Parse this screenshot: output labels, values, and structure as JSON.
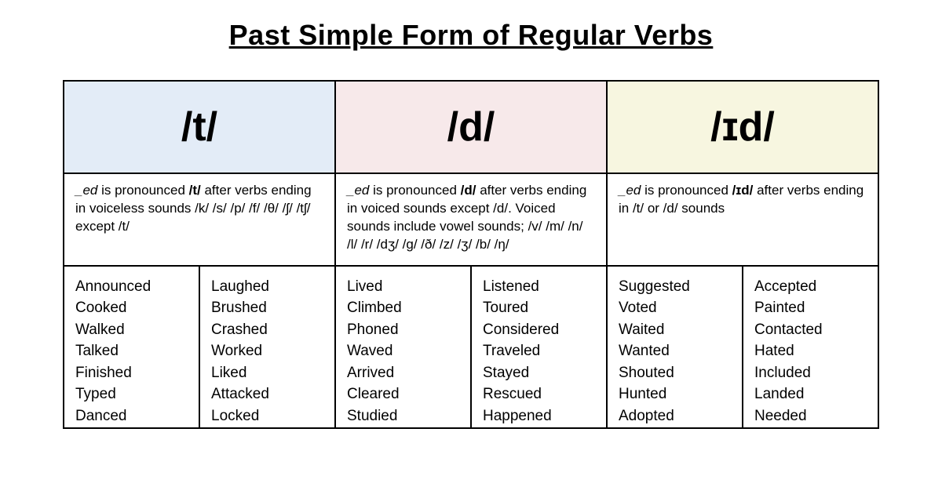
{
  "title": "Past Simple Form of Regular Verbs",
  "columns": [
    {
      "key": "t",
      "header": "/t/",
      "rule_prefix": "_ed",
      "rule_mid": " is pronounced ",
      "rule_phon": "/t/",
      "rule_tail": " after verbs ending in voiceless sounds /k/ /s/ /p/ /f/ /θ/ /ʃ/ /tʃ/ except /t/",
      "examples_left": [
        "Announced",
        "Cooked",
        "Walked",
        "Talked",
        "Finished",
        "Typed",
        "Danced"
      ],
      "examples_right": [
        "Laughed",
        "Brushed",
        "Crashed",
        "Worked",
        "Liked",
        "Attacked",
        "Locked"
      ]
    },
    {
      "key": "d",
      "header": "/d/",
      "rule_prefix": "_ed",
      "rule_mid": " is pronounced ",
      "rule_phon": "/d/",
      "rule_tail": " after verbs ending in voiced sounds except /d/. Voiced sounds include vowel sounds; /v/ /m/ /n/ /l/ /r/ /dʒ/ /g/ /ð/ /z/ /ʒ/ /b/ /ŋ/",
      "examples_left": [
        "Lived",
        "Climbed",
        "Phoned",
        "Waved",
        "Arrived",
        "Cleared",
        "Studied"
      ],
      "examples_right": [
        "Listened",
        "Toured",
        "Considered",
        "Traveled",
        "Stayed",
        "Rescued",
        "Happened"
      ]
    },
    {
      "key": "id",
      "header": "/ɪd/",
      "rule_prefix": "_ed",
      "rule_mid": " is pronounced ",
      "rule_phon": "/ɪd/",
      "rule_tail": " after verbs ending in /t/ or /d/ sounds",
      "examples_left": [
        "Suggested",
        "Voted",
        "Waited",
        "Wanted",
        "Shouted",
        "Hunted",
        "Adopted"
      ],
      "examples_right": [
        "Accepted",
        "Painted",
        "Contacted",
        "Hated",
        "Included",
        "Landed",
        "Needed"
      ]
    }
  ]
}
